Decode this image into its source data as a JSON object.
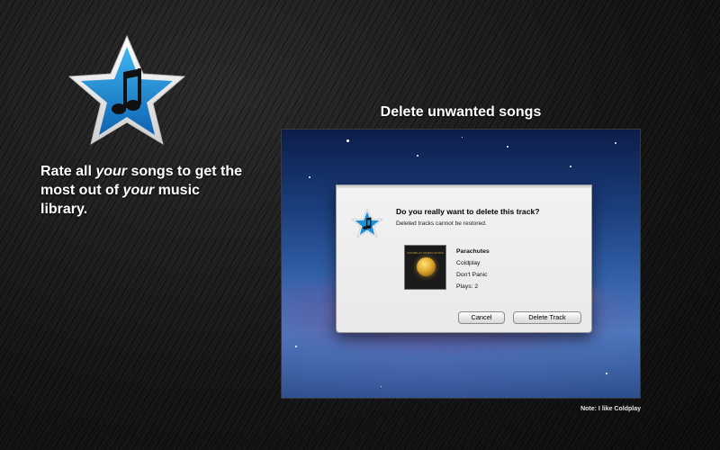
{
  "tagline": {
    "part1": "Rate all ",
    "em1": "your",
    "part2": " songs to get the most out of ",
    "em2": "your",
    "part3": " music library."
  },
  "headline": "Delete unwanted songs",
  "dialog": {
    "title": "Do you really want to delete this track?",
    "subtitle": "Deleted tracks cannot be restored.",
    "album_art_label": "COLDPLAY PARACHUTES",
    "track": {
      "album": "Parachutes",
      "artist": "Coldplay",
      "title": "Don't Panic",
      "plays": "Plays: 2"
    },
    "cancel_label": "Cancel",
    "delete_label": "Delete Track"
  },
  "note": "Note: I like Coldplay",
  "icons": {
    "app": "star-music-note-icon",
    "dialog": "star-music-note-icon"
  },
  "colors": {
    "star_blue": "#1f8fd6",
    "star_border": "#f2f2f2",
    "background": "#151515"
  }
}
